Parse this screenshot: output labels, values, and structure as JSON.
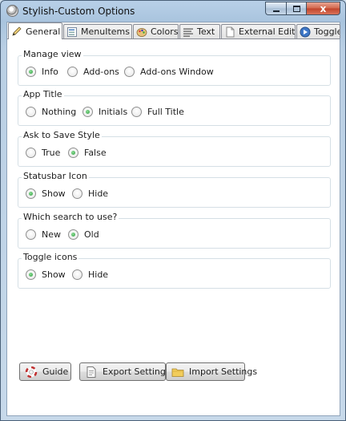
{
  "window": {
    "title": "Stylish-Custom Options",
    "controls": {
      "minimize": "",
      "maximize": "",
      "close": "x"
    }
  },
  "tabs": [
    {
      "label": "General",
      "icon": "pencil-icon",
      "active": true
    },
    {
      "label": "MenuItems",
      "icon": "menu-list-icon",
      "active": false
    },
    {
      "label": "Colors",
      "icon": "palette-icon",
      "active": false
    },
    {
      "label": "Text",
      "icon": "text-lines-icon",
      "active": false
    },
    {
      "label": "External Editor",
      "icon": "document-icon",
      "active": false
    },
    {
      "label": "Toggle",
      "icon": "toggle-icon",
      "active": false
    }
  ],
  "groups": [
    {
      "title": "Manage view",
      "options": [
        {
          "label": "Info",
          "checked": true
        },
        {
          "label": "Add-ons",
          "checked": false
        },
        {
          "label": "Add-ons Window",
          "checked": false
        }
      ]
    },
    {
      "title": "App Title",
      "options": [
        {
          "label": "Nothing",
          "checked": false
        },
        {
          "label": "Initials",
          "checked": true
        },
        {
          "label": "Full Title",
          "checked": false
        }
      ]
    },
    {
      "title": "Ask to Save Style",
      "options": [
        {
          "label": "True",
          "checked": false
        },
        {
          "label": "False",
          "checked": true
        }
      ]
    },
    {
      "title": "Statusbar Icon",
      "options": [
        {
          "label": "Show",
          "checked": true
        },
        {
          "label": "Hide",
          "checked": false
        }
      ]
    },
    {
      "title": "Which search to use?",
      "options": [
        {
          "label": "New",
          "checked": false
        },
        {
          "label": "Old",
          "checked": true
        }
      ]
    },
    {
      "title": "Toggle icons",
      "options": [
        {
          "label": "Show",
          "checked": true
        },
        {
          "label": "Hide",
          "checked": false
        }
      ]
    }
  ],
  "buttons": {
    "guide": {
      "label": "Guide",
      "icon": "lifebuoy-icon"
    },
    "export": {
      "label": "Export Settings",
      "icon": "export-document-icon"
    },
    "import": {
      "label": "Import Settings",
      "icon": "folder-icon"
    }
  },
  "colors": {
    "radio_checked": "#2c9a3a",
    "close_button": "#c0432a",
    "title_bar": "#a9c4de"
  }
}
